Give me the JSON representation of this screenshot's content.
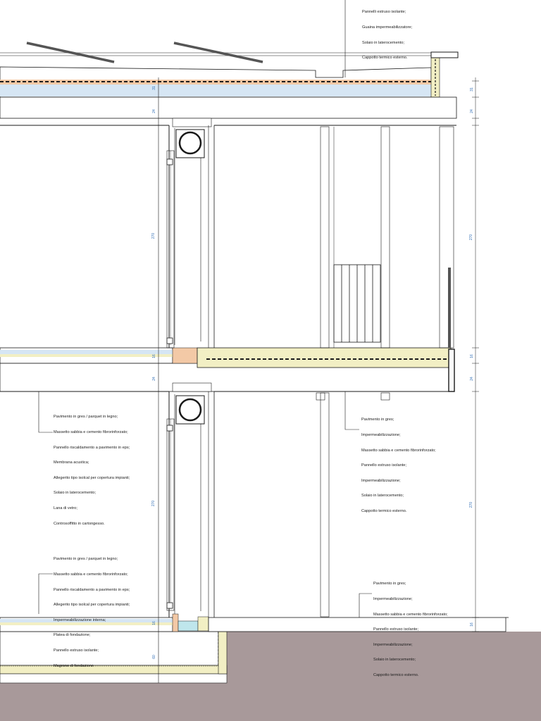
{
  "colors": {
    "line": "#1a1a1a",
    "insulation_orange": "#f3c9a6",
    "insulation_blue": "#d6e6f4",
    "screed_yellow": "#f2efc4",
    "ground": "#a8999a",
    "panel_olive": "#e9e3b8",
    "dimension_blue": "#2f6db5",
    "glass_cyan": "#bfe6ec"
  },
  "notes": {
    "roof": [
      "Pannelli estruso isolante;",
      "Guaina impermeabilizzatore;",
      "Solaio in laterocemento;",
      "Cappotto termico esterno."
    ],
    "floor_left": [
      "Pavimento in gres / parquet in legno;",
      "Massetto sabbia e cemento fibrorinforzato;",
      "Pannello riscaldamento a pavimento in eps;",
      "Membrana acustica;",
      "Allegerito tipo isolcal per copertura impianti;",
      "Solaio in laterocemento;",
      "Lana di vetro;",
      "Controsoffitto in cartongesso."
    ],
    "floor_right": [
      "Pavimento in gres;",
      "Impermeabilizzazione;",
      "Massetto sabbia e cemento fibrorinforzato;",
      "Pannello estruso isolante;",
      "Impermeabilizzazione;",
      "Solaio in laterocemento;",
      "Cappotto termico esterno."
    ],
    "ground_left": [
      "Pavimento in gres / parquet in legno;",
      "Massetto sabbia e cemento fibrorinforzato;",
      "Pannello riscaldamento a pavimento in eps;",
      "Allegerito tipo isolcal per copertura impianti;",
      "Impermeabilizzazione interna;",
      "Platea di fondazione;",
      "Pannello estruso isolante;",
      "Magrone di fondazione"
    ],
    "ground_right": [
      "Pavimento in gres;",
      "Impermeabilizzazione;",
      "Massetto sabbia e cemento fibrorinforzato;",
      "Pannello estruso isolante;",
      "Impermeabilizzazione;",
      "Solaio in laterocemento;",
      "Cappotto termico esterno."
    ]
  },
  "dimensions": {
    "roof_top": "31",
    "roof_slab": "24",
    "upper_storey_left": "270",
    "upper_storey_right": "270",
    "floor_pkg": "16",
    "floor_slab": "24",
    "lower_storey_left": "270",
    "lower_storey_right": "270",
    "ground_pkg": "16",
    "foundation": "60"
  }
}
